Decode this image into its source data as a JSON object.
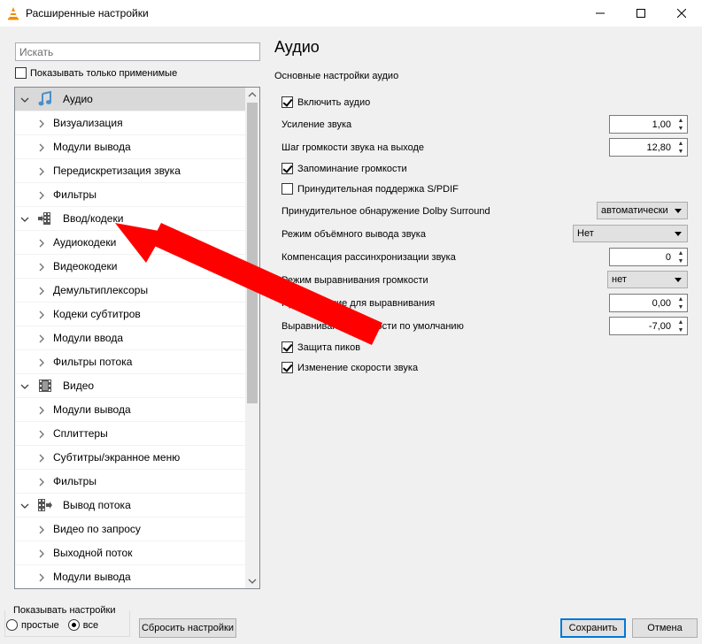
{
  "window": {
    "title": "Расширенные настройки"
  },
  "search": {
    "placeholder": "Искать",
    "value": ""
  },
  "only_applicable": {
    "label": "Показывать только применимые",
    "checked": false
  },
  "tree": {
    "items": [
      {
        "type": "category",
        "label": "Аудио",
        "icon": "music-note-icon",
        "expanded": true,
        "selected": true
      },
      {
        "type": "child",
        "label": "Визуализация"
      },
      {
        "type": "child",
        "label": "Модули вывода"
      },
      {
        "type": "child",
        "label": "Передискретизация звука"
      },
      {
        "type": "child",
        "label": "Фильтры"
      },
      {
        "type": "category",
        "label": "Ввод/кодеки",
        "icon": "film-input-icon",
        "expanded": true
      },
      {
        "type": "child",
        "label": "Аудиокодеки"
      },
      {
        "type": "child",
        "label": "Видеокодеки"
      },
      {
        "type": "child",
        "label": "Демультиплексоры"
      },
      {
        "type": "child",
        "label": "Кодеки субтитров"
      },
      {
        "type": "child",
        "label": "Модули ввода"
      },
      {
        "type": "child",
        "label": "Фильтры потока"
      },
      {
        "type": "category",
        "label": "Видео",
        "icon": "film-video-icon",
        "expanded": true
      },
      {
        "type": "child",
        "label": "Модули вывода"
      },
      {
        "type": "child",
        "label": "Сплиттеры"
      },
      {
        "type": "child",
        "label": "Субтитры/экранное меню"
      },
      {
        "type": "child",
        "label": "Фильтры"
      },
      {
        "type": "category",
        "label": "Вывод потока",
        "icon": "stream-output-icon",
        "expanded": true
      },
      {
        "type": "child",
        "label": "Видео по запросу"
      },
      {
        "type": "child",
        "label": "Выходной поток"
      },
      {
        "type": "child",
        "label": "Модули вывода"
      }
    ]
  },
  "panel": {
    "title": "Аудио",
    "subtitle": "Основные настройки аудио",
    "enable_audio": {
      "label": "Включить аудио",
      "checked": true
    },
    "gain": {
      "label": "Усиление звука",
      "value": "1,00"
    },
    "volume_step": {
      "label": "Шаг громкости звука на выходе",
      "value": "12,80"
    },
    "remember_volume": {
      "label": "Запоминание громкости",
      "checked": true
    },
    "force_spdif": {
      "label": "Принудительная поддержка S/PDIF",
      "checked": false
    },
    "dolby": {
      "label": "Принудительное обнаружение Dolby Surround",
      "value": "автоматически"
    },
    "surround_mode": {
      "label": "Режим объёмного вывода звука",
      "value": "Нет"
    },
    "desync": {
      "label": "Компенсация рассинхронизации звука",
      "value": "0"
    },
    "replay_gain_mode": {
      "label": "Режим выравнивания громкости",
      "value": "нет"
    },
    "preamp": {
      "label": "Предусиление для выравнивания",
      "value": "0,00"
    },
    "default_gain": {
      "label": "Выравнивание громкости по умолчанию",
      "value": "-7,00"
    },
    "peak_protect": {
      "label": "Защита пиков",
      "checked": true
    },
    "time_stretch": {
      "label": "Изменение скорости звука",
      "checked": true
    }
  },
  "bottom": {
    "show_settings_label": "Показывать настройки",
    "simple_label": "простые",
    "all_label": "все",
    "selected_mode": "all",
    "reset_label": "Сбросить настройки",
    "save_label": "Сохранить",
    "cancel_label": "Отмена"
  },
  "annotation": {
    "arrow_color": "#ff0000"
  }
}
